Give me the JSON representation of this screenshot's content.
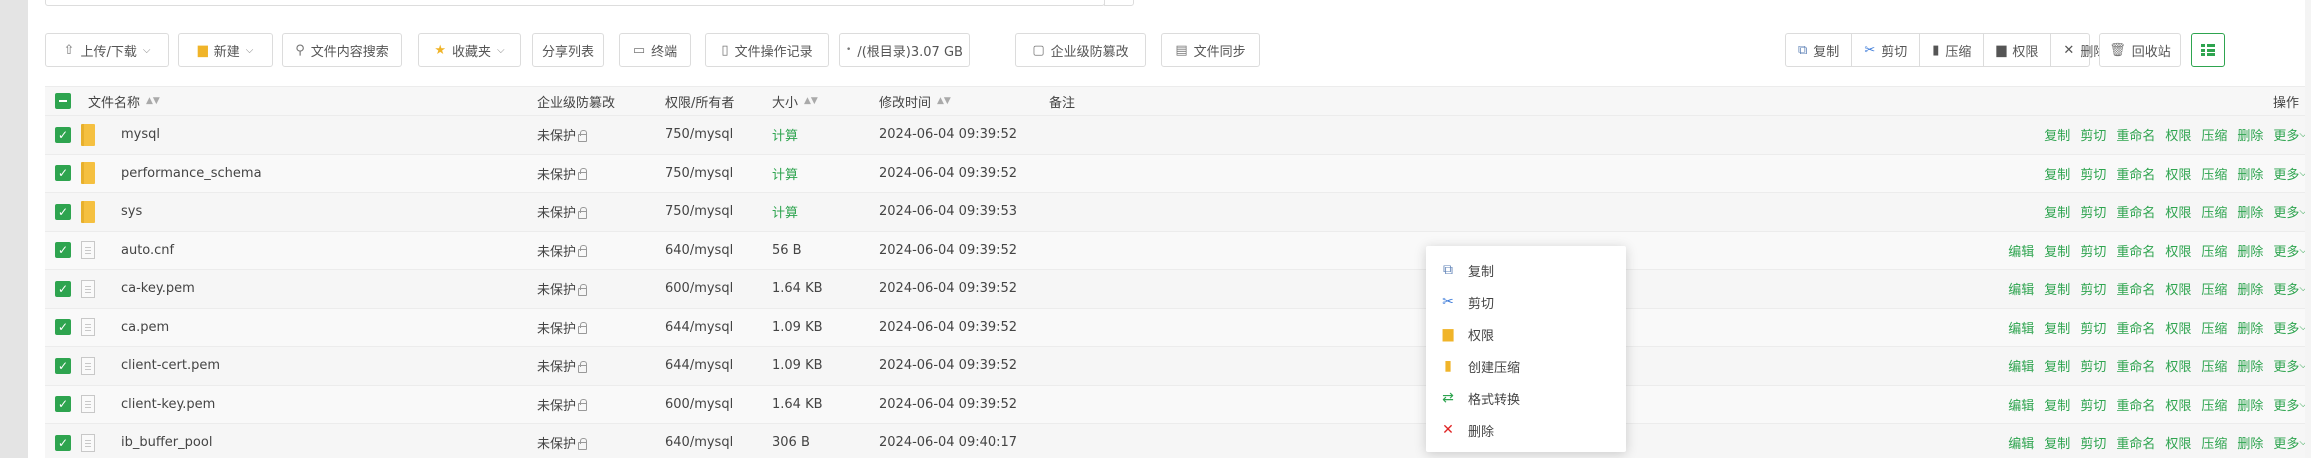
{
  "toolbar": {
    "upload_download": "上传/下载",
    "new": "新建",
    "search_content": "文件内容搜索",
    "favorites": "收藏夹",
    "share_list": "分享列表",
    "terminal": "终端",
    "op_log": "文件操作记录",
    "path_label": "/(根目录)3.07 GB",
    "tamper": "企业级防篡改",
    "sync": "文件同步",
    "copy": "复制",
    "cut": "剪切",
    "compress": "压缩",
    "permission": "权限",
    "delete": "删除",
    "recycle": "回收站"
  },
  "table": {
    "headers": {
      "name": "文件名称",
      "tamper": "企业级防篡改",
      "perm_owner": "权限/所有者",
      "size": "大小",
      "mtime": "修改时间",
      "remark": "备注",
      "ops": "操作"
    },
    "rows": [
      {
        "name": "mysql",
        "type": "folder",
        "tamper": "未保护",
        "perm": "750/mysql",
        "size": "计算",
        "mtime": "2024-06-04 09:39:52"
      },
      {
        "name": "performance_schema",
        "type": "folder",
        "tamper": "未保护",
        "perm": "750/mysql",
        "size": "计算",
        "mtime": "2024-06-04 09:39:52"
      },
      {
        "name": "sys",
        "type": "folder",
        "tamper": "未保护",
        "perm": "750/mysql",
        "size": "计算",
        "mtime": "2024-06-04 09:39:53"
      },
      {
        "name": "auto.cnf",
        "type": "file",
        "tamper": "未保护",
        "perm": "640/mysql",
        "size": "56 B",
        "mtime": "2024-06-04 09:39:52"
      },
      {
        "name": "ca-key.pem",
        "type": "file",
        "tamper": "未保护",
        "perm": "600/mysql",
        "size": "1.64 KB",
        "mtime": "2024-06-04 09:39:52"
      },
      {
        "name": "ca.pem",
        "type": "file",
        "tamper": "未保护",
        "perm": "644/mysql",
        "size": "1.09 KB",
        "mtime": "2024-06-04 09:39:52"
      },
      {
        "name": "client-cert.pem",
        "type": "file",
        "tamper": "未保护",
        "perm": "644/mysql",
        "size": "1.09 KB",
        "mtime": "2024-06-04 09:39:52"
      },
      {
        "name": "client-key.pem",
        "type": "file",
        "tamper": "未保护",
        "perm": "600/mysql",
        "size": "1.64 KB",
        "mtime": "2024-06-04 09:39:52"
      },
      {
        "name": "ib_buffer_pool",
        "type": "file",
        "tamper": "未保护",
        "perm": "640/mysql",
        "size": "306 B",
        "mtime": "2024-06-04 09:40:17"
      }
    ],
    "row_ops": {
      "edit": "编辑",
      "copy": "复制",
      "cut": "剪切",
      "rename": "重命名",
      "perm": "权限",
      "compress": "压缩",
      "delete": "删除",
      "more": "更多"
    }
  },
  "context_menu": {
    "items": [
      "复制",
      "剪切",
      "权限",
      "创建压缩",
      "格式转换",
      "删除"
    ]
  },
  "colors": {
    "accent": "#2ea44f",
    "danger": "#e02424",
    "folder": "#f5c040"
  }
}
